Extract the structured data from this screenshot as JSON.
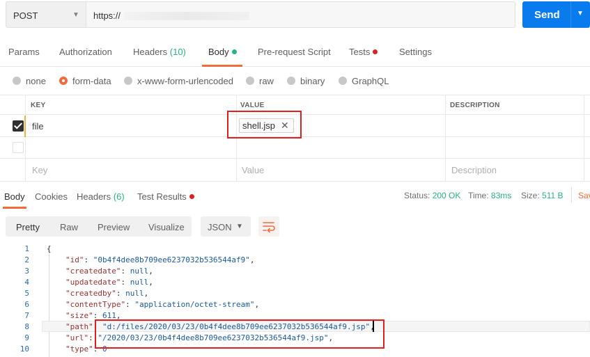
{
  "request": {
    "method": "POST",
    "url": "https://",
    "send_label": "Send"
  },
  "request_tabs": {
    "params": "Params",
    "authorization": "Authorization",
    "headers": "Headers",
    "headers_count": "(10)",
    "body": "Body",
    "prerequest": "Pre-request Script",
    "tests": "Tests",
    "settings": "Settings"
  },
  "body_types": {
    "none": "none",
    "form_data": "form-data",
    "urlencoded": "x-www-form-urlencoded",
    "raw": "raw",
    "binary": "binary",
    "graphql": "GraphQL",
    "selected": "form-data"
  },
  "form_table": {
    "headers": {
      "key": "KEY",
      "value": "VALUE",
      "description": "DESCRIPTION"
    },
    "rows": [
      {
        "checked": true,
        "key": "file",
        "value": "shell.jsp"
      }
    ],
    "placeholders": {
      "key": "Key",
      "value": "Value",
      "description": "Description"
    }
  },
  "response_tabs": {
    "body": "Body",
    "cookies": "Cookies",
    "headers": "Headers",
    "headers_count": "(6)",
    "test_results": "Test Results"
  },
  "response_status": {
    "status_label": "Status:",
    "status_value": "200 OK",
    "time_label": "Time:",
    "time_value": "83ms",
    "size_label": "Size:",
    "size_value": "511 B",
    "save_label": "Sav"
  },
  "view_modes": {
    "pretty": "Pretty",
    "raw": "Raw",
    "preview": "Preview",
    "visualize": "Visualize",
    "format": "JSON"
  },
  "response_lines": [
    {
      "num": "1",
      "text": "{"
    },
    {
      "num": "2",
      "key": "\"id\"",
      "sep": ": ",
      "value": "\"0b4f4dee8b709ee6237032b536544af9\"",
      "tail": ","
    },
    {
      "num": "3",
      "key": "\"createdate\"",
      "sep": ": ",
      "value": "null",
      "tail": ","
    },
    {
      "num": "4",
      "key": "\"updatedate\"",
      "sep": ": ",
      "value": "null",
      "tail": ","
    },
    {
      "num": "5",
      "key": "\"createdby\"",
      "sep": ": ",
      "value": "null",
      "tail": ","
    },
    {
      "num": "6",
      "key": "\"contentType\"",
      "sep": ": ",
      "value": "\"application/octet-stream\"",
      "tail": ","
    },
    {
      "num": "7",
      "key": "\"size\"",
      "sep": ": ",
      "value": "611",
      "tail": ","
    },
    {
      "num": "8",
      "key": "\"path\"",
      "sep": ": ",
      "value": "\"d:/files/2020/03/23/0b4f4dee8b709ee6237032b536544af9.jsp\"",
      "tail": ","
    },
    {
      "num": "9",
      "key": "\"url\"",
      "sep": ": ",
      "value": "\"/2020/03/23/0b4f4dee8b709ee6237032b536544af9.jsp\"",
      "tail": ","
    },
    {
      "num": "10",
      "key": "\"type\"",
      "sep": ": ",
      "value": "0",
      "tail": ""
    }
  ],
  "colors": {
    "accent": "#f26b3a",
    "send": "#097bed",
    "success": "#26b47f",
    "indicator_dot": "#e02020",
    "highlight_box": "#e02020"
  }
}
